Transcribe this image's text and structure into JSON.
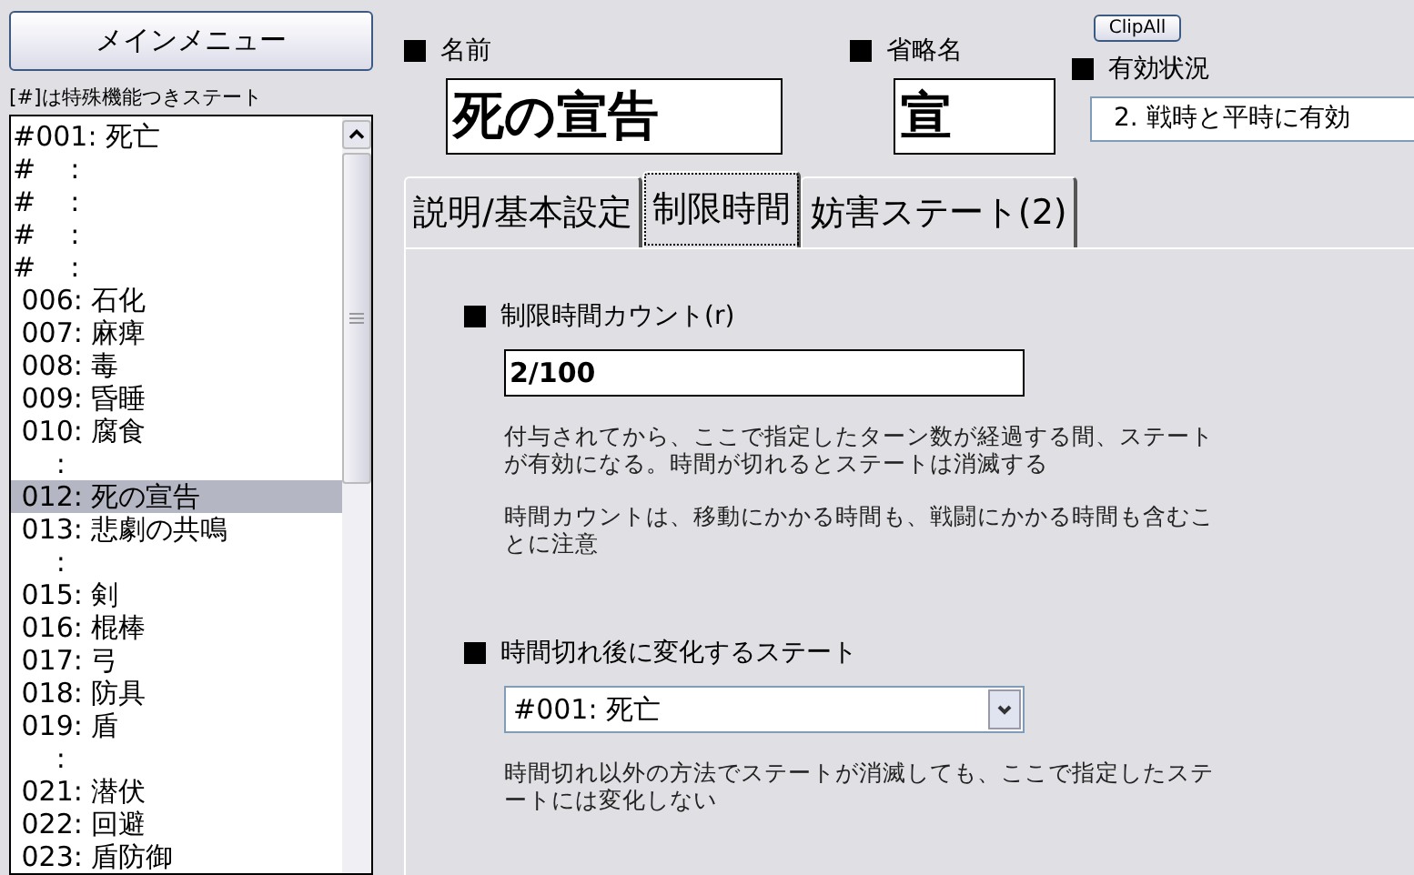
{
  "main_menu_button": "メインメニュー",
  "list_caption": "[#]は特殊機能つきステート",
  "state_list": [
    {
      "text": "#001: 死亡",
      "selected": false
    },
    {
      "text": "#    :",
      "selected": false
    },
    {
      "text": "#    :",
      "selected": false
    },
    {
      "text": "#    :",
      "selected": false
    },
    {
      "text": "#    :",
      "selected": false
    },
    {
      "text": " 006: 石化",
      "selected": false
    },
    {
      "text": " 007: 麻痺",
      "selected": false
    },
    {
      "text": " 008: 毒",
      "selected": false
    },
    {
      "text": " 009: 昏睡",
      "selected": false
    },
    {
      "text": " 010: 腐食",
      "selected": false
    },
    {
      "text": "     :",
      "selected": false
    },
    {
      "text": " 012: 死の宣告",
      "selected": true
    },
    {
      "text": " 013: 悲劇の共鳴",
      "selected": false
    },
    {
      "text": "     :",
      "selected": false
    },
    {
      "text": " 015: 剣",
      "selected": false
    },
    {
      "text": " 016: 棍棒",
      "selected": false
    },
    {
      "text": " 017: 弓",
      "selected": false
    },
    {
      "text": " 018: 防具",
      "selected": false
    },
    {
      "text": " 019: 盾",
      "selected": false
    },
    {
      "text": "     :",
      "selected": false
    },
    {
      "text": " 021: 潜伏",
      "selected": false
    },
    {
      "text": " 022: 回避",
      "selected": false
    },
    {
      "text": " 023: 盾防御",
      "selected": false
    }
  ],
  "name": {
    "label": "名前",
    "value": "死の宣告"
  },
  "abbreviation": {
    "label": "省略名",
    "value": "宣"
  },
  "clip_all_button": "ClipAll",
  "validity": {
    "label": "有効状況",
    "value": "2. 戦時と平時に有効"
  },
  "tabs": [
    {
      "label": "説明/基本設定",
      "selected": false
    },
    {
      "label": "制限時間",
      "selected": true
    },
    {
      "label": "妨害ステート(2)",
      "selected": false
    }
  ],
  "time_limit": {
    "label": "制限時間カウント(r)",
    "value": "2/100",
    "notes": [
      "付与されてから、ここで指定したターン数が経過する間、ステートが有効になる。時間が切れるとステートは消滅する",
      "時間カウントは、移動にかかる時間も、戦闘にかかる時間も含むことに注意"
    ]
  },
  "after_state": {
    "label": "時間切れ後に変化するステート",
    "value": "#001: 死亡",
    "notes": [
      "時間切れ以外の方法でステートが消滅しても、ここで指定したステートには変化しない"
    ]
  }
}
